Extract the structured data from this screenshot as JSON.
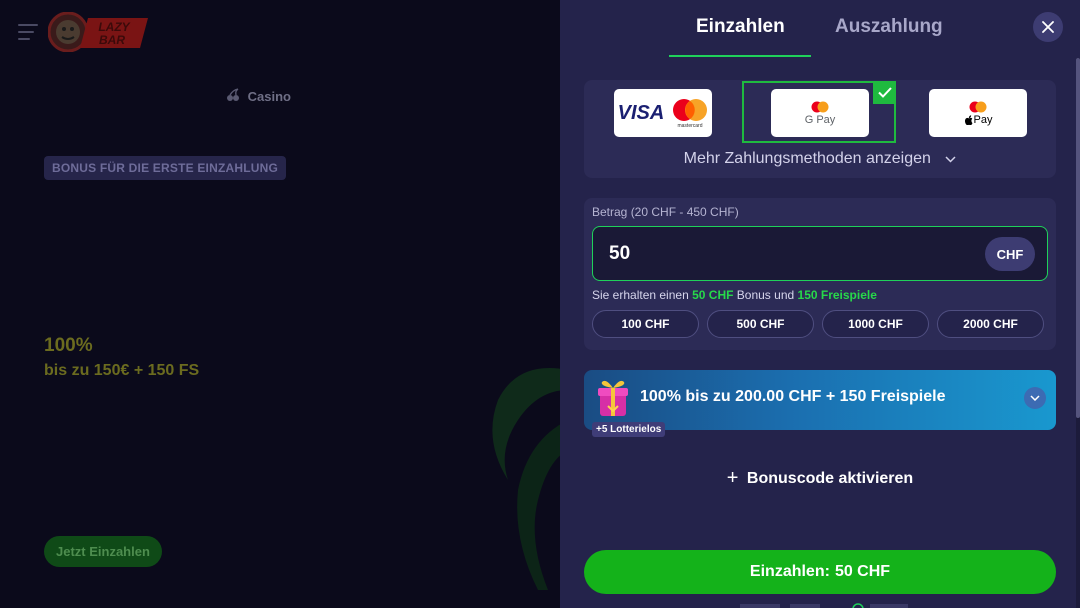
{
  "background": {
    "nav": {
      "casino_label": "Casino"
    },
    "bonus_badge": "BONUS FÜR DIE ERSTE EINZAHLUNG",
    "promo": {
      "percent": "100%",
      "subtitle": "bis zu 150€ + 150 FS"
    },
    "cta_label": "Jetzt Einzahlen",
    "logo_text": [
      "LAZY",
      "BAR"
    ]
  },
  "drawer": {
    "tabs": [
      {
        "label": "Einzahlen",
        "active": true
      },
      {
        "label": "Auszahlung",
        "active": false
      }
    ],
    "payment_methods": [
      {
        "name": "visa-mastercard",
        "label_visa": "VISA",
        "label_mc": "mastercard",
        "selected": false
      },
      {
        "name": "google-pay",
        "label": "G Pay",
        "selected": true
      },
      {
        "name": "apple-pay",
        "label": "Pay",
        "selected": false
      }
    ],
    "more_methods_label": "Mehr Zahlungsmethoden anzeigen",
    "amount": {
      "label": "Betrag (20 CHF - 450 CHF)",
      "value": "50",
      "currency": "CHF"
    },
    "bonus_info": {
      "prefix": "Sie erhalten einen",
      "bonus_amount": "50 CHF",
      "middle": "Bonus und",
      "freespins": "150 Freispiele"
    },
    "quick_amounts": [
      "100 CHF",
      "500 CHF",
      "1000 CHF",
      "2000 CHF"
    ],
    "offer": {
      "text": "100% bis zu 200.00 CHF + 150 Freispiele",
      "badge": "+5 Lotterielos"
    },
    "promo_code_label": "Bonuscode aktivieren",
    "deposit_button": {
      "label": "Einzahlen:",
      "amount": "50 CHF"
    }
  },
  "colors": {
    "accent_green": "#1fd15a",
    "deposit_green": "#14b21a",
    "drawer_bg": "#24234b",
    "panel_bg": "#2c2b56"
  }
}
